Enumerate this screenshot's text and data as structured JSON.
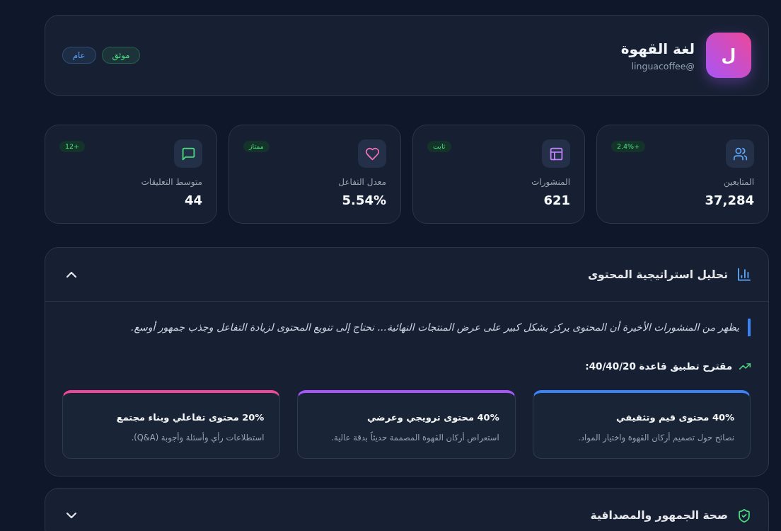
{
  "profile": {
    "avatar_letter": "ل",
    "name": "لغة القهوة",
    "handle": "@linguacoffee",
    "badges": [
      {
        "label": "موثق",
        "color": "#4ade80"
      },
      {
        "label": "عام",
        "color": "#60a5fa"
      }
    ]
  },
  "stats": [
    {
      "kind": "followers",
      "label": "المتابعين",
      "value": "37,284",
      "badge": "+2.4%"
    },
    {
      "kind": "posts",
      "label": "المنشورات",
      "value": "621",
      "badge": "ثابت"
    },
    {
      "kind": "engagement",
      "label": "معدل التفاعل",
      "value": "5.54%",
      "badge": "ممتاز"
    },
    {
      "kind": "comments",
      "label": "متوسط التعليقات",
      "value": "44",
      "badge": "+12"
    }
  ],
  "sections": [
    {
      "kind": "content",
      "title": "تحليل استراتيجية المحتوى",
      "expanded": true,
      "note": "يظهر من المنشورات الأخيرة أن المحتوى يركز بشكل كبير على عرض المنتجات النهائية... نحتاج إلى تنويع المحتوى لزيادة التفاعل وجذب جمهور أوسع.",
      "suggestion": "مقترح تطبيق قاعدة 40/40/20:",
      "items": [
        {
          "title": "40% محتوى قيم وتثقيفي",
          "description": "نصائح حول تصميم أركان القهوة واختيار المواد.",
          "color": "#3b82f6"
        },
        {
          "title": "40% محتوى ترويجي وعرضي",
          "description": "استعراض أركان القهوة المصممة حديثاً بدقة عالية.",
          "color": "#a855f7"
        },
        {
          "title": "20% محتوى تفاعلي وبناء مجتمع",
          "description": "استطلاعات رأي وأسئلة وأجوبة (Q&A).",
          "color": "#ec4899"
        }
      ]
    },
    {
      "kind": "audience",
      "title": "صحة الجمهور والمصداقية",
      "expanded": false
    }
  ]
}
